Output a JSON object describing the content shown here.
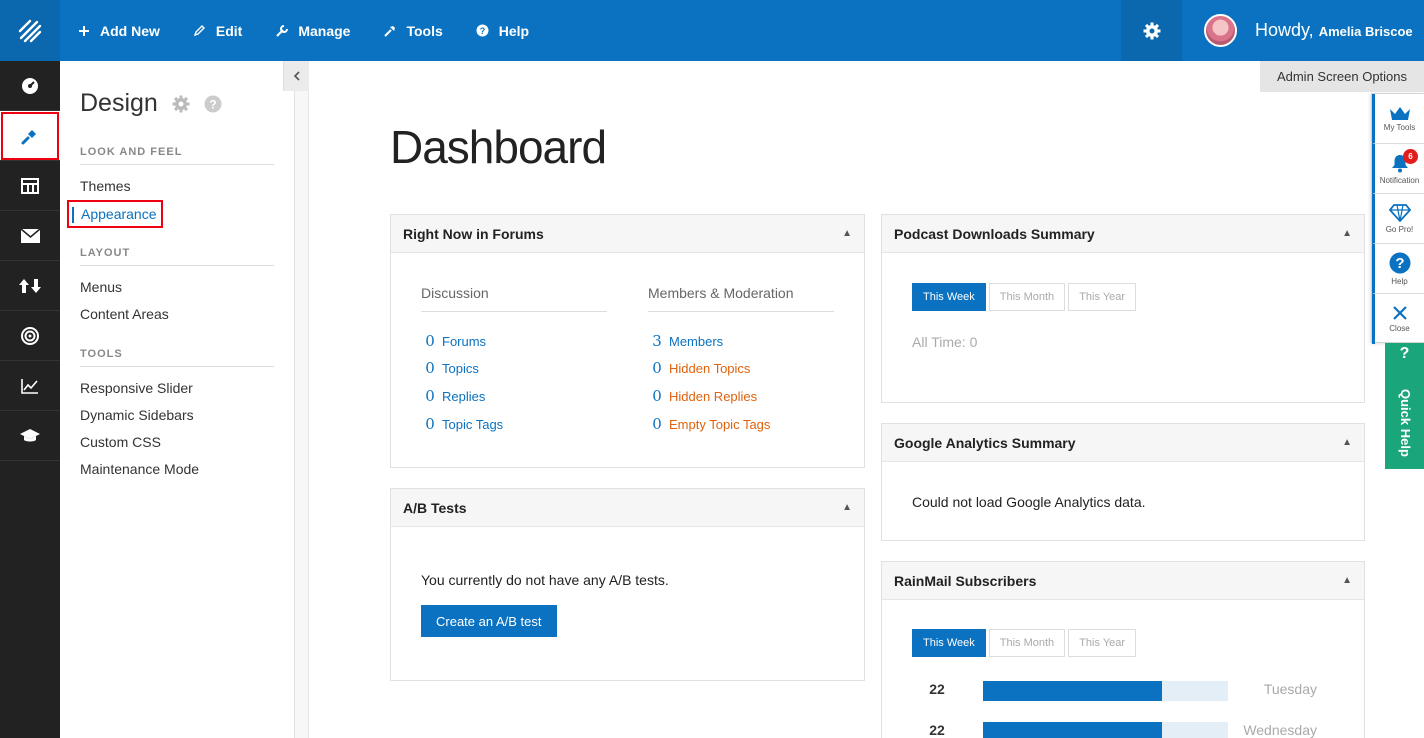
{
  "topnav": {
    "items": [
      {
        "label": "Add New",
        "icon": "plus-icon"
      },
      {
        "label": "Edit",
        "icon": "pencil-icon"
      },
      {
        "label": "Manage",
        "icon": "wrench-icon"
      },
      {
        "label": "Tools",
        "icon": "hammer-icon"
      },
      {
        "label": "Help",
        "icon": "question-icon"
      }
    ],
    "howdy": "Howdy,",
    "user_name": "Amelia Briscoe"
  },
  "screen_options": "Admin Screen Options",
  "submenu": {
    "title": "Design",
    "sections": [
      {
        "label": "LOOK AND FEEL",
        "links": [
          "Themes",
          "Appearance"
        ]
      },
      {
        "label": "LAYOUT",
        "links": [
          "Menus",
          "Content Areas"
        ]
      },
      {
        "label": "TOOLS",
        "links": [
          "Responsive Slider",
          "Dynamic Sidebars",
          "Custom CSS",
          "Maintenance Mode"
        ]
      }
    ]
  },
  "page": {
    "title": "Dashboard"
  },
  "forums": {
    "title": "Right Now in Forums",
    "discussion_label": "Discussion",
    "moderation_label": "Members & Moderation",
    "discussion": [
      {
        "num": "0",
        "label": "Forums"
      },
      {
        "num": "0",
        "label": "Topics"
      },
      {
        "num": "0",
        "label": "Replies"
      },
      {
        "num": "0",
        "label": "Topic Tags"
      }
    ],
    "moderation": [
      {
        "num": "3",
        "label": "Members"
      },
      {
        "num": "0",
        "label": "Hidden Topics"
      },
      {
        "num": "0",
        "label": "Hidden Replies"
      },
      {
        "num": "0",
        "label": "Empty Topic Tags"
      }
    ]
  },
  "ab": {
    "title": "A/B Tests",
    "message": "You currently do not have any A/B tests.",
    "button": "Create an A/B test"
  },
  "podcast": {
    "title": "Podcast Downloads Summary",
    "tabs": [
      "This Week",
      "This Month",
      "This Year"
    ],
    "all_time": "All Time: 0"
  },
  "analytics": {
    "title": "Google Analytics Summary",
    "message": "Could not load Google Analytics data."
  },
  "rainmail": {
    "title": "RainMail Subscribers",
    "tabs": [
      "This Week",
      "This Month",
      "This Year"
    ],
    "rows": [
      {
        "value": "22",
        "fraction": 0.73,
        "day": "Tuesday"
      },
      {
        "value": "22",
        "fraction": 0.73,
        "day": "Wednesday"
      }
    ]
  },
  "right_tools": {
    "items": [
      {
        "label": "My Tools",
        "icon": "crown-icon"
      },
      {
        "label": "Notification",
        "icon": "bell-icon",
        "badge": "6"
      },
      {
        "label": "Go Pro!",
        "icon": "diamond-icon"
      },
      {
        "label": "Help",
        "icon": "help-circle-icon"
      },
      {
        "label": "Close",
        "icon": "close-icon"
      }
    ],
    "quick_help_mark": "?",
    "quick_help": "Quick Help"
  },
  "colors": {
    "brand": "#0a72c0",
    "warning": "#e0620d",
    "quick_help": "#1aa57a",
    "badge": "#e21d1d"
  }
}
